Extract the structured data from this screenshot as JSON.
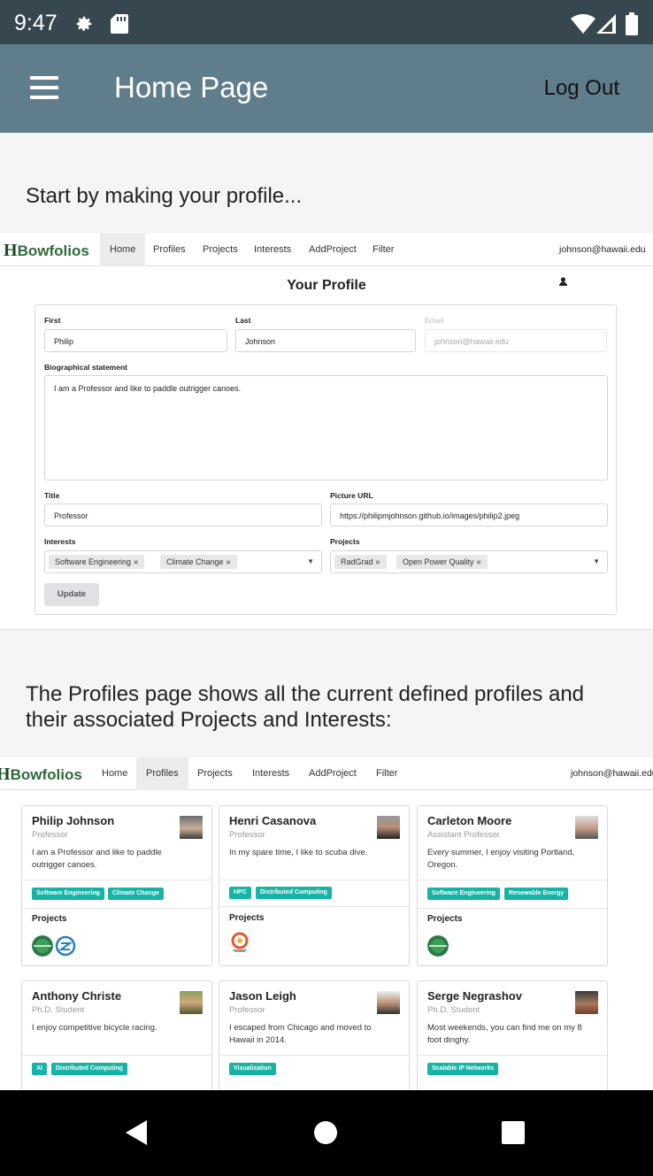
{
  "status_bar": {
    "time": "9:47",
    "icons": [
      "gear-icon",
      "sd-card-icon",
      "wifi-icon",
      "signal-icon",
      "battery-icon"
    ]
  },
  "app_bar": {
    "title": "Home Page",
    "logout_label": "Log Out",
    "menu_icon": "hamburger-menu-icon"
  },
  "intro_text": "Start by making your profile...",
  "profiles_intro_text": "The Profiles page shows all the current defined profiles and their associated Projects and Interests:",
  "colors": {
    "status_bar": "#37474f",
    "app_bar": "#607d8b",
    "tag": "#16b4a6",
    "logo_green": "#2e6b3a"
  },
  "profile_shot": {
    "logo": "Bowfolios",
    "logo_mark": "H",
    "nav": [
      "Home",
      "Profiles",
      "Projects",
      "Interests",
      "AddProject",
      "Filter"
    ],
    "active_nav": "Home",
    "user_email": "johnson@hawaii.edu",
    "heading": "Your Profile",
    "labels": {
      "first": "First",
      "last": "Last",
      "email": "Email",
      "bio": "Biographical statement",
      "title": "Title",
      "picture": "Picture URL",
      "interests": "Interests",
      "projects": "Projects"
    },
    "values": {
      "first": "Philip",
      "last": "Johnson",
      "email": "johnson@hawaii.edu",
      "bio": "I am a Professor and like to paddle outrigger canoes.",
      "title": "Professor",
      "picture": "https://philipmjohnson.github.io/images/philip2.jpeg"
    },
    "interests": [
      "Software Engineering",
      "Climate Change"
    ],
    "projects": [
      "RadGrad",
      "Open Power Quality"
    ],
    "chip_remove": "✖",
    "update_label": "Update"
  },
  "profiles_shot": {
    "logo": "Bowfolios",
    "logo_mark": "H",
    "nav": [
      "Home",
      "Profiles",
      "Projects",
      "Interests",
      "AddProject",
      "Filter"
    ],
    "active_nav": "Profiles",
    "user_email": "johnson@hawaii.edu",
    "projects_label": "Projects",
    "cards": [
      {
        "name": "Philip Johnson",
        "title": "Professor",
        "bio": "I am a Professor and like to paddle outrigger canoes.",
        "tags": [
          "Software Engineering",
          "Climate Change"
        ]
      },
      {
        "name": "Henri Casanova",
        "title": "Professor",
        "bio": "In my spare time, I like to scuba dive.",
        "tags": [
          "HPC",
          "Distributed Computing"
        ]
      },
      {
        "name": "Carleton Moore",
        "title": "Assistant Professor",
        "bio": "Every summer, I enjoy visiting Portland, Oregon.",
        "tags": [
          "Software Engineering",
          "Renewable Energy"
        ]
      },
      {
        "name": "Anthony Christe",
        "title": "Ph.D. Student",
        "bio": "I enjoy competitive bicycle racing.",
        "tags": [
          "AI",
          "Distributed Computing"
        ]
      },
      {
        "name": "Jason Leigh",
        "title": "Professor",
        "bio": "I escaped from Chicago and moved to Hawaii in 2014.",
        "tags": [
          "Visualization"
        ]
      },
      {
        "name": "Serge Negrashov",
        "title": "Ph.D. Student",
        "bio": "Most weekends, you can find me on my 8 foot dinghy.",
        "tags": [
          "Scalable IP Networks"
        ]
      }
    ]
  },
  "nav_bar": {
    "icons": [
      "back-icon",
      "home-icon",
      "recents-icon"
    ]
  }
}
